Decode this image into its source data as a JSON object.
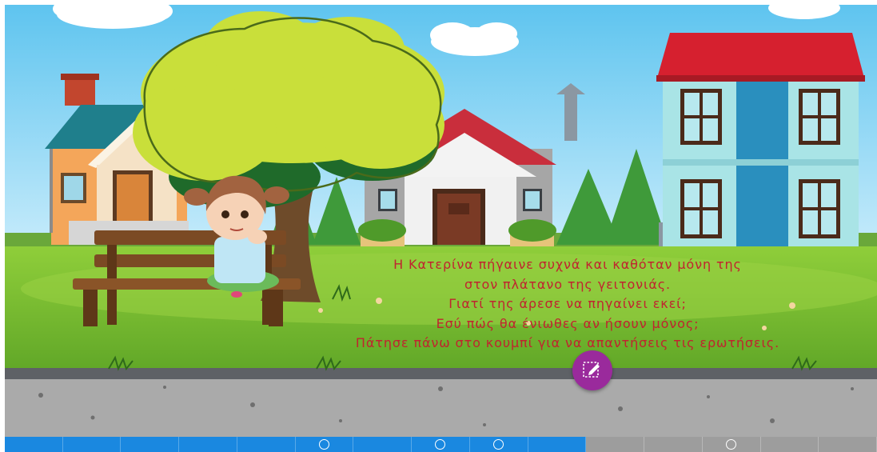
{
  "story": {
    "lines": [
      "Η Κατερίνα πήγαινε συχνά και καθόταν μόνη της",
      "στον πλάτανο της γειτονιάς.",
      "Γιατί της άρεσε να πηγαίνει εκεί;",
      "Εσύ πώς θα ένιωθες αν ήσουν μόνος;",
      "Πάτησε πάνω στο κουμπί για να απαντήσεις τις ερωτήσεις."
    ],
    "color": "#c0242f"
  },
  "answer_button": {
    "icon": "edit-pencil-icon",
    "color": "#9a2a9c"
  },
  "progress": {
    "segments_total": 15,
    "segments_completed": 10,
    "marked_segments": [
      6,
      8,
      9,
      13
    ],
    "completed_color": "#1a88e0",
    "remaining_color": "#9d9d9d"
  },
  "scene": {
    "icons": [
      "houses",
      "tree",
      "bench",
      "girl",
      "road",
      "clouds"
    ]
  }
}
